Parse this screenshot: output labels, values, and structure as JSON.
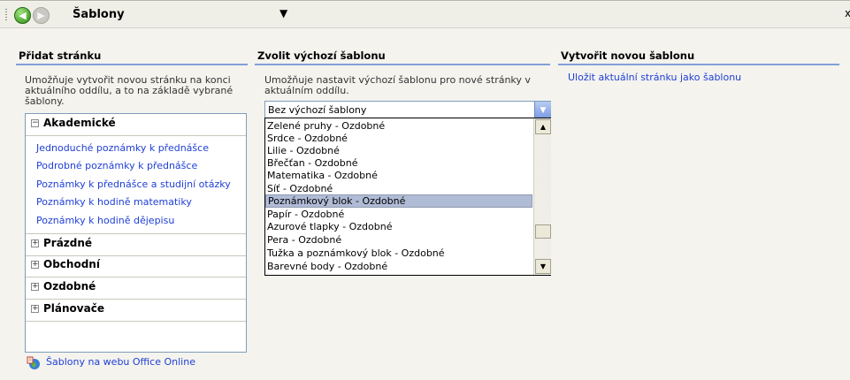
{
  "titlebar": {
    "title": "Šablony",
    "menu_arrow": "▼",
    "close": "x"
  },
  "add_page": {
    "header": "Přidat stránku",
    "description": "Umožňuje vytvořit novou stránku na konci aktuálního oddílu, a to na základě vybrané šablony.",
    "categories": [
      {
        "label": "Akademické",
        "expanded": true,
        "toggle": "−"
      },
      {
        "label": "Prázdné",
        "expanded": false,
        "toggle": "+"
      },
      {
        "label": "Obchodní",
        "expanded": false,
        "toggle": "+"
      },
      {
        "label": "Ozdobné",
        "expanded": false,
        "toggle": "+"
      },
      {
        "label": "Plánovače",
        "expanded": false,
        "toggle": "+"
      }
    ],
    "templates": [
      "Jednoduché poznámky k přednášce",
      "Podrobné poznámky k přednášce",
      "Poznámky k přednášce a studijní otázky",
      "Poznámky k hodině matematiky",
      "Poznámky k hodině dějepisu"
    ]
  },
  "default_template": {
    "header": "Zvolit výchozí šablonu",
    "description": "Umožňuje nastavit výchozí šablonu pro nové stránky v aktuálním oddílu.",
    "selected_value": "Bez výchozí šablony",
    "options": [
      "Zelené pruhy - Ozdobné",
      "Srdce - Ozdobné",
      "Lilie - Ozdobné",
      "Břečťan - Ozdobné",
      "Matematika - Ozdobné",
      "Síť - Ozdobné",
      "Poznámkový blok - Ozdobné",
      "Papír - Ozdobné",
      "Azurové tlapky - Ozdobné",
      "Pera - Ozdobné",
      "Tužka a poznámkový blok - Ozdobné",
      "Barevné body - Ozdobné"
    ],
    "highlighted_option": "Poznámkový blok - Ozdobné"
  },
  "new_template": {
    "header": "Vytvořit novou šablonu",
    "link": "Uložit aktuální stránku jako šablonu"
  },
  "footer": {
    "link": "Šablony na webu Office Online"
  },
  "colors": {
    "link": "#1f3fd6",
    "header_rule": "#7fa1d6",
    "selection": "#b0bcd6"
  }
}
